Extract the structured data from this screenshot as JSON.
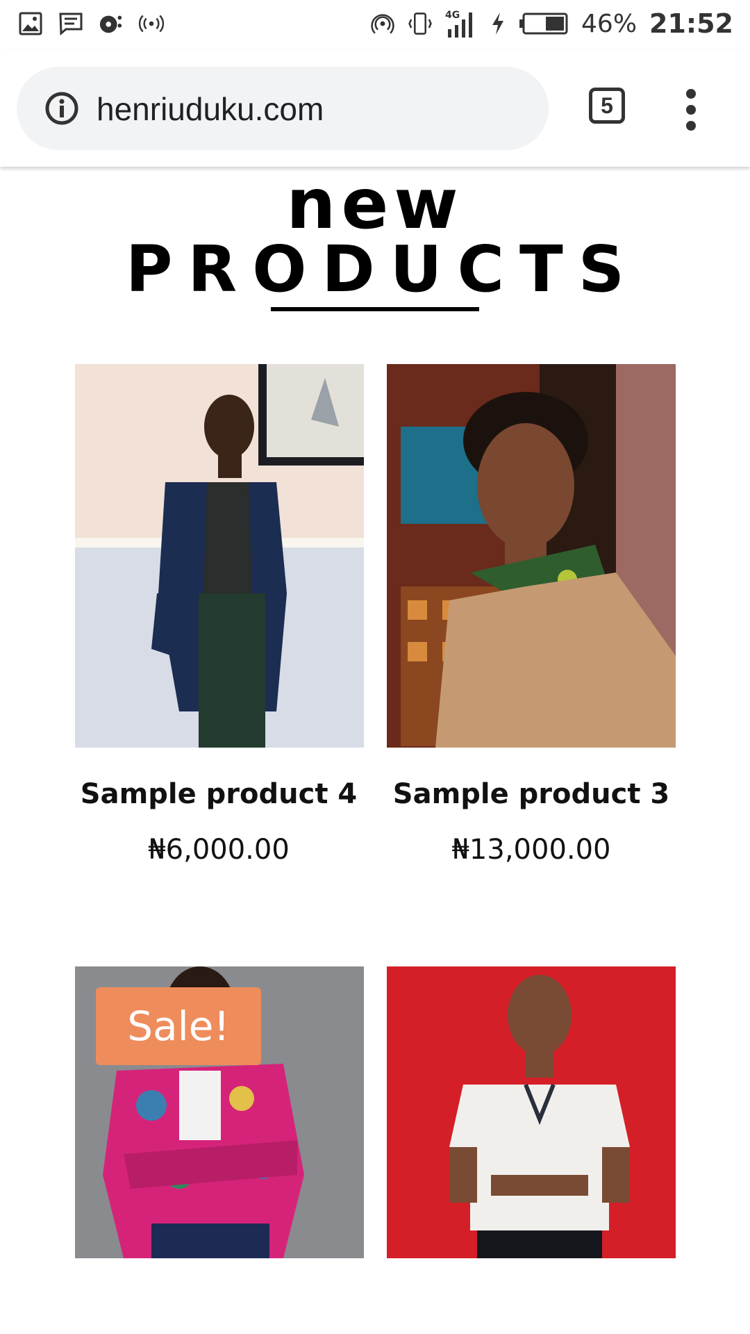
{
  "status_bar": {
    "battery": "46%",
    "time": "21:52",
    "network": "4G"
  },
  "browser": {
    "url": "henriuduku.com",
    "tab_count": "5"
  },
  "section": {
    "title_line1": "new",
    "title_line2": "PRODUCTS"
  },
  "products": [
    {
      "name": "Sample product 4",
      "price": "₦6,000.00"
    },
    {
      "name": "Sample product 3",
      "price": "₦13,000.00"
    },
    {
      "badge": "Sale!"
    },
    {}
  ],
  "colors": {
    "sale_badge": "#ef8c5b",
    "url_pill": "#f1f3f4"
  }
}
